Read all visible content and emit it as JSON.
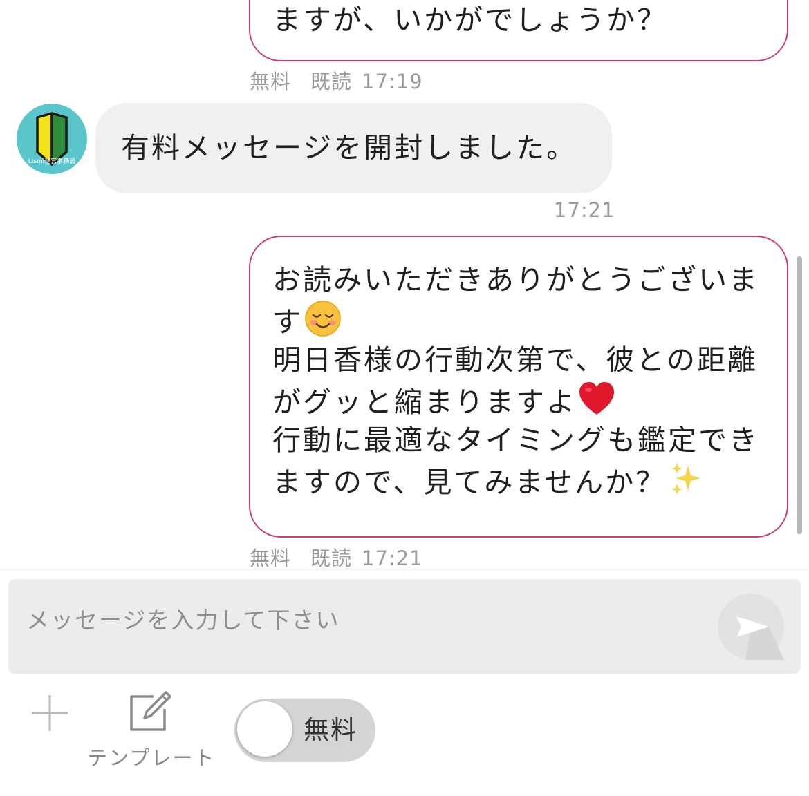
{
  "messages": [
    {
      "direction": "outgoing",
      "lines": [
        "ますが、いかがでしょうか？"
      ],
      "price": "無料",
      "read": "既読",
      "time": "17:19"
    },
    {
      "direction": "incoming",
      "sender": "Lismi運営事務局",
      "lines": [
        "有料メッセージを開封しました。"
      ],
      "time": "17:21"
    },
    {
      "direction": "outgoing",
      "lines": [
        "お読みいただきありがとうございま",
        "す",
        "明日香様の行動次第で、彼との距離",
        "がグッと縮まりますよ",
        "行動に最適なタイミングも鑑定でき",
        "ますので、見てみませんか？"
      ],
      "emojis": [
        "smiling-face-emoji",
        "red-heart-emoji",
        "sparkles-emoji"
      ],
      "price": "無料",
      "read": "既読",
      "time": "17:21"
    }
  ],
  "composer": {
    "placeholder": "メッセージを入力して下さい",
    "send_icon": "send-icon",
    "add_icon": "plus-icon",
    "template_label": "テンプレート",
    "template_icon": "edit-icon",
    "price_toggle_label": "無料",
    "price_toggle_on": false
  },
  "colors": {
    "outgoing_border": "#c9416b",
    "incoming_bg": "#f0f0f0",
    "avatar_bg": "#5bc5cc",
    "meta_text": "#9a9a9a"
  }
}
